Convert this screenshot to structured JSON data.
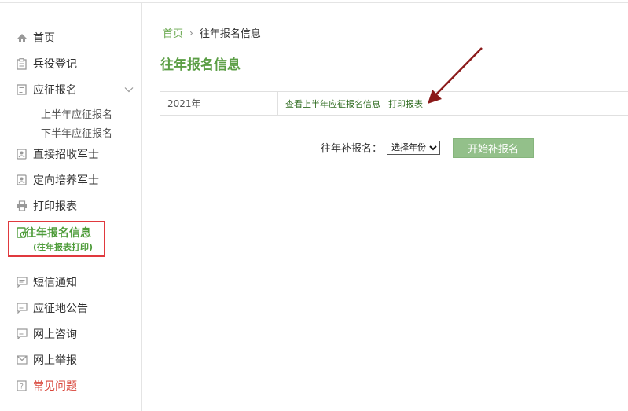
{
  "sidebar": {
    "items": [
      {
        "label": "首页",
        "icon": "home-icon"
      },
      {
        "label": "兵役登记",
        "icon": "clipboard-icon"
      },
      {
        "label": "应征报名",
        "icon": "document-icon"
      },
      {
        "label": "直接招收军士",
        "icon": "id-card-icon"
      },
      {
        "label": "定向培养军士",
        "icon": "id-card-icon"
      },
      {
        "label": "打印报表",
        "icon": "printer-icon"
      },
      {
        "label": "短信通知",
        "icon": "chat-icon"
      },
      {
        "label": "应征地公告",
        "icon": "chat-icon"
      },
      {
        "label": "网上咨询",
        "icon": "chat-icon"
      },
      {
        "label": "网上举报",
        "icon": "mail-icon"
      },
      {
        "label": "常见问题",
        "icon": "question-icon"
      }
    ],
    "sub_items": [
      "上半年应征报名",
      "下半年应征报名"
    ],
    "active": {
      "label": "往年报名信息",
      "sub_label": "(往年报表打印)"
    }
  },
  "breadcrumb": {
    "home": "首页",
    "separator": "›",
    "current": "往年报名信息"
  },
  "page_title": "往年报名信息",
  "table": {
    "year": "2021年",
    "link_view": "查看上半年应征报名信息",
    "link_print": "打印报表"
  },
  "supplement": {
    "label": "往年补报名：",
    "select_value": "选择年份",
    "button": "开始补报名"
  },
  "colors": {
    "accent": "#5b9e45",
    "highlight_box": "#e0393e",
    "arrow": "#8b1a1a",
    "question": "#d9453a"
  }
}
